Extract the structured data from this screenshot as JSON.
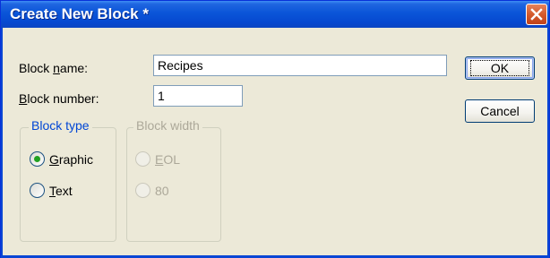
{
  "window": {
    "title": "Create New Block *",
    "colors": {
      "titlebar": "#0a55d8",
      "face": "#ece9d8",
      "close": "#d45a2c"
    }
  },
  "form": {
    "block_name": {
      "label_pre": "Block ",
      "label_mnemonic": "n",
      "label_post": "ame:",
      "value": "Recipes"
    },
    "block_number": {
      "label_mnemonic": "B",
      "label_post": "lock number:",
      "value": "1"
    }
  },
  "buttons": {
    "ok": "OK",
    "cancel": "Cancel"
  },
  "block_type": {
    "caption": "Block type",
    "options": [
      {
        "mnemonic": "G",
        "rest": "raphic",
        "selected": true
      },
      {
        "mnemonic": "T",
        "rest": "ext",
        "selected": false
      }
    ]
  },
  "block_width": {
    "caption": "Block width",
    "enabled": false,
    "options": [
      {
        "mnemonic": "E",
        "rest": "OL",
        "selected": false
      },
      {
        "mnemonic": "",
        "rest": "80",
        "selected": false
      }
    ]
  },
  "icons": {
    "close": "close-icon",
    "radio": "radio-icon"
  }
}
